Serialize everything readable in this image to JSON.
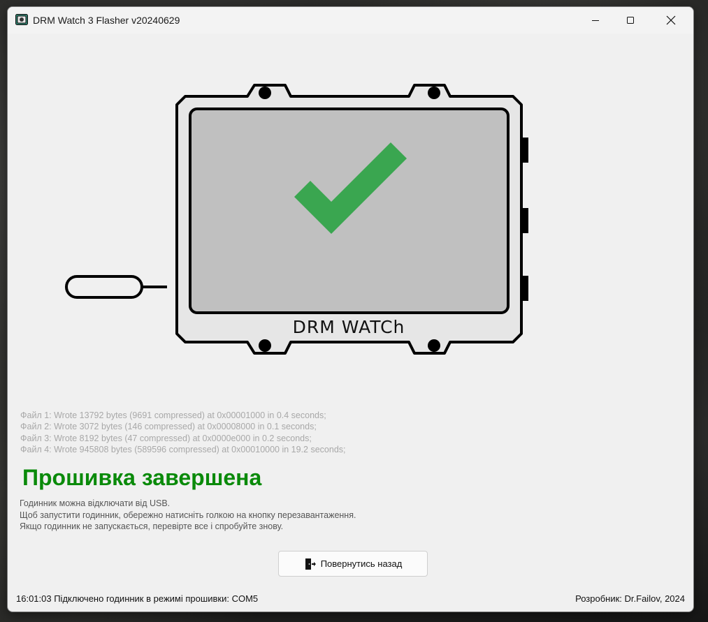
{
  "window": {
    "title": "DRM Watch 3 Flasher v20240629"
  },
  "device": {
    "label": "DRM WATCh",
    "check_color": "#3aa650",
    "screen_color": "#c0c0c0"
  },
  "log": [
    "Файл 1: Wrote 13792 bytes (9691 compressed) at 0x00001000 in 0.4 seconds;",
    "Файл 2: Wrote 3072 bytes (146 compressed) at 0x00008000 in 0.1 seconds;",
    "Файл 3: Wrote 8192 bytes (47 compressed) at 0x0000e000 in 0.2 seconds;",
    "Файл 4: Wrote 945808 bytes (589596 compressed) at 0x00010000 in 19.2 seconds;"
  ],
  "result": {
    "title": "Прошивка завершена",
    "title_color": "#0a8a0a",
    "lines": [
      "Годинник можна відключати від USB.",
      "Щоб запустити годинник, обережно натисніть голкою на кнопку перезавантаження.",
      "Якщо годинник не запускається, перевірте все і спробуйте знову."
    ]
  },
  "buttons": {
    "back_label": "Повернутись назад",
    "back_icon": "exit-door-icon"
  },
  "status": {
    "left": "16:01:03 Підключено годинник в режимі прошивки: COM5",
    "right": "Розробник: Dr.Failov, 2024"
  }
}
